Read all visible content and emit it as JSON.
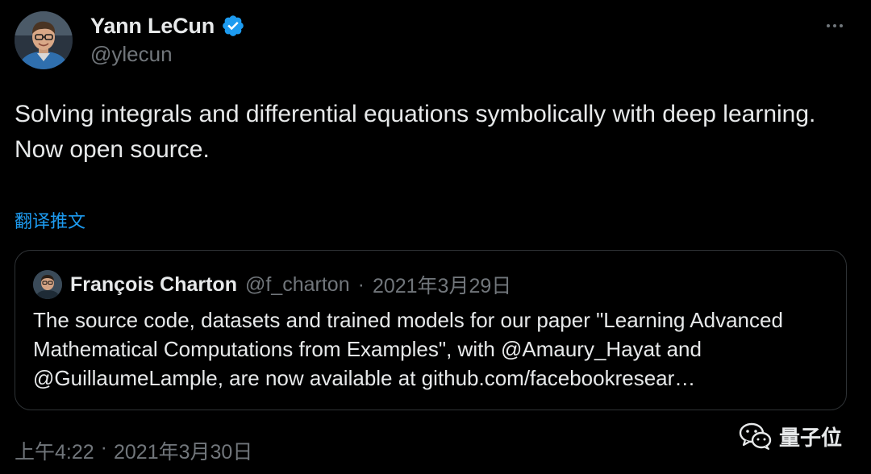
{
  "author": {
    "display_name": "Yann LeCun",
    "handle": "@ylecun",
    "verified": true
  },
  "tweet": {
    "text_lines": [
      "Solving integrals and differential equations symbolically with deep learning.",
      "Now open source."
    ],
    "translate_label": "翻译推文"
  },
  "quote": {
    "author_name": "François Charton",
    "author_handle": "@f_charton",
    "separator": "·",
    "date": "2021年3月29日",
    "text": "The source code, datasets and trained models for our paper \"Learning Advanced Mathematical Computations from Examples\", with @Amaury_Hayat and @GuillaumeLample, are now available at github.com/facebookresear…"
  },
  "footer": {
    "time": "上午4:22",
    "separator": "·",
    "date": "2021年3月30日"
  },
  "watermark": {
    "text": "量子位"
  },
  "colors": {
    "background": "#000000",
    "text_primary": "#e7e9ea",
    "text_secondary": "#71767b",
    "accent_link": "#1d9bf0",
    "card_border": "#2f3336"
  },
  "icons": {
    "verified": "verified-badge-icon",
    "more": "more-options-icon",
    "watermark": "wechat-logo-icon"
  }
}
